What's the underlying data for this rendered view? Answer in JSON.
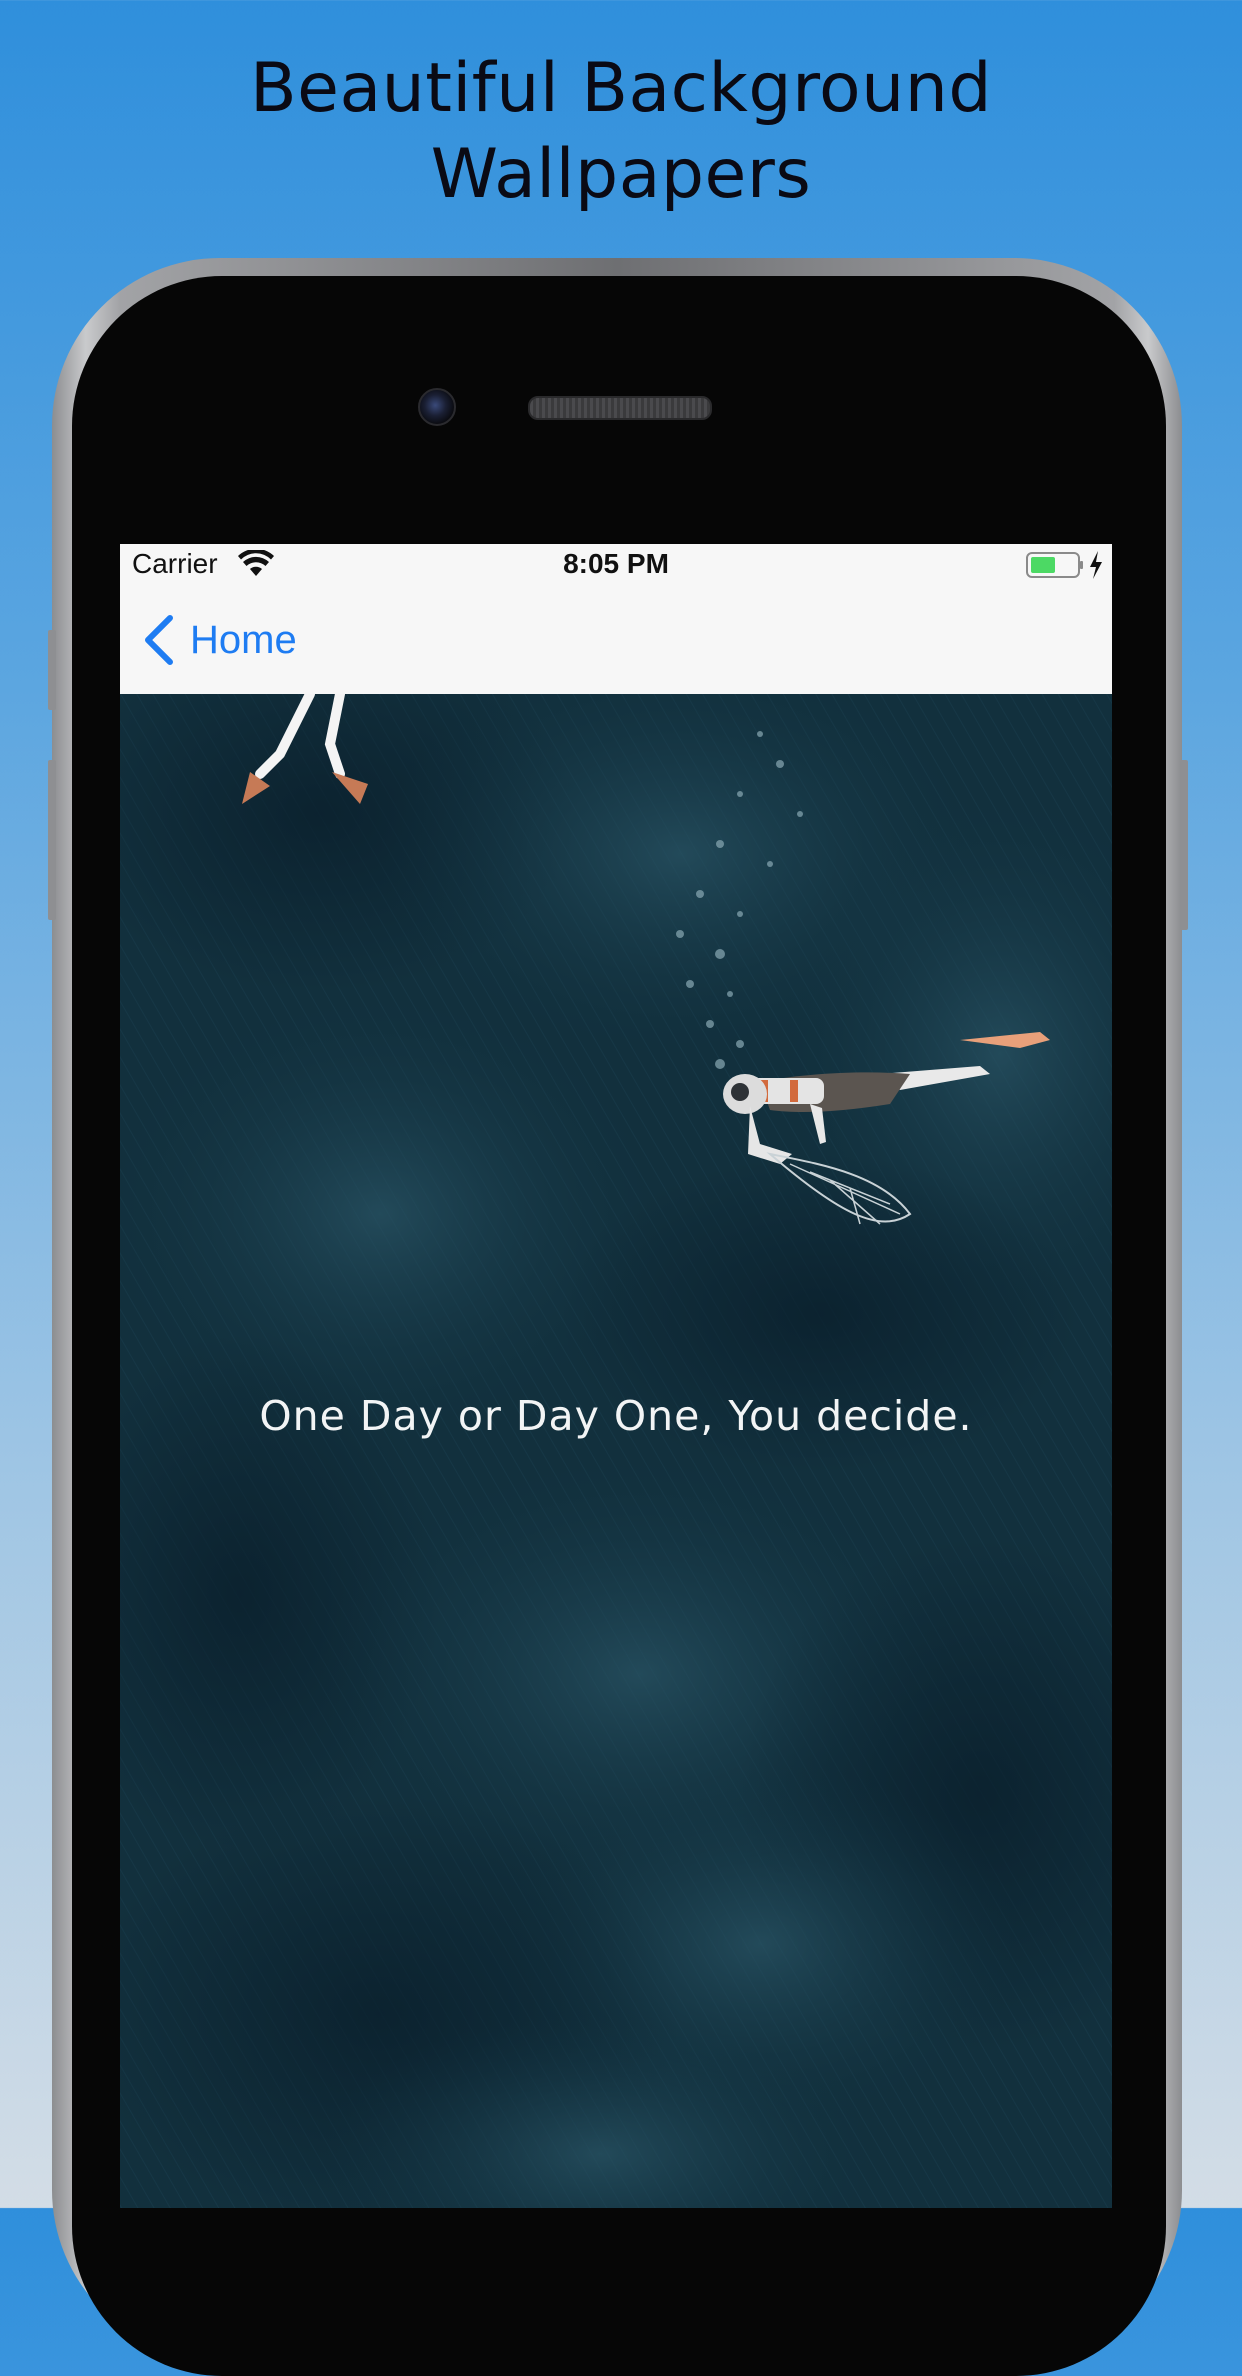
{
  "promo": {
    "headline_line1": "Beautiful Background",
    "headline_line2": "Wallpapers"
  },
  "status_bar": {
    "carrier": "Carrier",
    "time": "8:05 PM",
    "wifi_icon": "wifi-icon",
    "battery_icon": "battery-icon",
    "charging_icon": "bolt-icon"
  },
  "nav": {
    "back_label": "Home",
    "back_icon": "chevron-left-icon"
  },
  "wallpaper": {
    "quote": "One Day or Day One, You decide.",
    "theme": "underwater scuba diver illustration",
    "base_color": "#0f2f3c"
  },
  "colors": {
    "accent": "#1e7cf2",
    "battery_fill": "#4cd964"
  }
}
